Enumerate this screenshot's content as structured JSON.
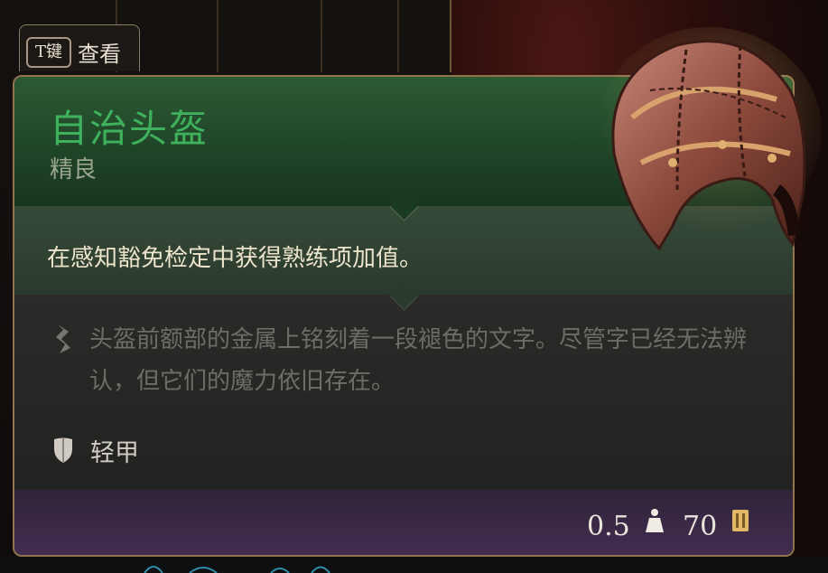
{
  "key_hint": {
    "key": "T键",
    "action": "查看"
  },
  "item": {
    "name": "自治头盔",
    "rarity": "精良",
    "effect": "在感知豁免检定中获得熟练项加值。",
    "description": "头盔前额部的金属上铭刻着一段褪色的文字。尽管字已经无法辨认，但它们的魔力依旧存在。",
    "armor_type": "轻甲",
    "weight": "0.5",
    "value": "70"
  },
  "colors": {
    "name_color": "#3fb15d",
    "header_bg": "#2c5a33",
    "footer_bg": "#3c2a48",
    "border": "#8f744e"
  },
  "icons": {
    "description": "quill-icon",
    "armor": "shield-icon",
    "weight": "weight-icon",
    "value": "gold-coin-icon",
    "item_art": "helmet-icon"
  }
}
